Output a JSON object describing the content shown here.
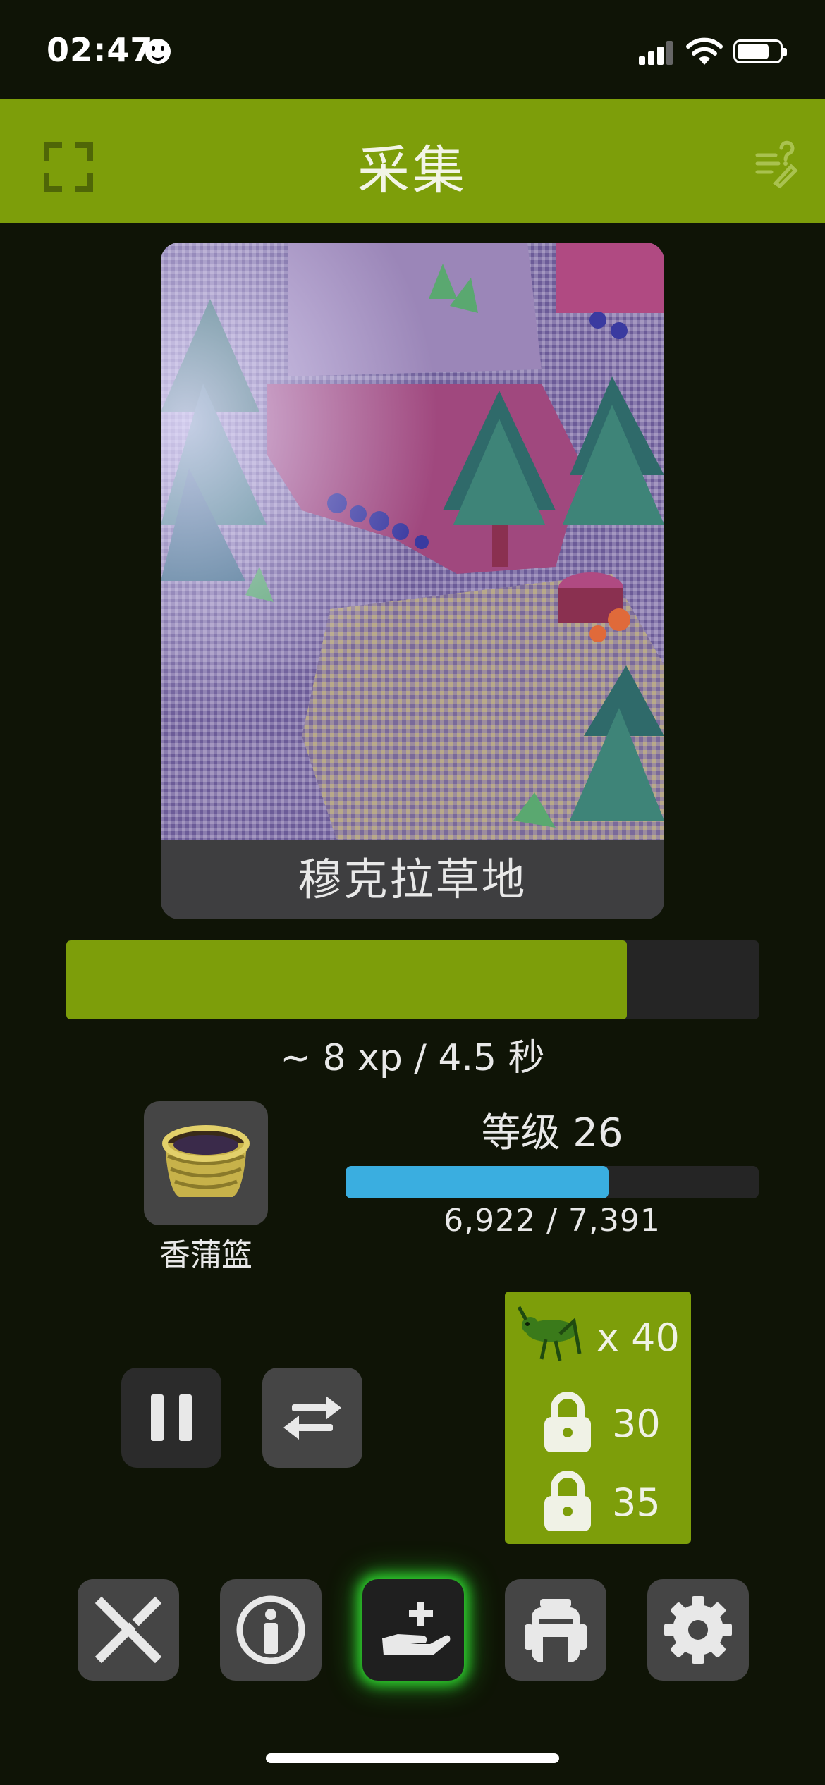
{
  "status_bar": {
    "time": "02:47"
  },
  "header": {
    "title": "采集"
  },
  "location": {
    "name": "穆克拉草地"
  },
  "gathering": {
    "progress_fraction": 0.81,
    "xp_rate": "~ 8 xp / 4.5 秒"
  },
  "tool": {
    "name": "香蒲篮"
  },
  "skill": {
    "level_label": "等级 26",
    "xp_current": 6922,
    "xp_next": 7391,
    "xp_text": "6,922 / 7,391"
  },
  "loot": [
    {
      "icon": "grasshopper-icon",
      "text": "x 40",
      "locked": false
    },
    {
      "icon": "lock-icon",
      "text": "30",
      "locked": true
    },
    {
      "icon": "lock-icon",
      "text": "35",
      "locked": true
    }
  ],
  "nav": [
    {
      "name": "crossed-swords-icon",
      "active": false
    },
    {
      "name": "character-info-icon",
      "active": false
    },
    {
      "name": "gather-hand-icon",
      "active": true
    },
    {
      "name": "backpack-icon",
      "active": false
    },
    {
      "name": "gear-icon",
      "active": false
    }
  ],
  "colors": {
    "accent": "#7d9e0a",
    "background": "#0f1406",
    "xp_bar": "#3aaee0",
    "active_glow": "#2fd62f"
  }
}
